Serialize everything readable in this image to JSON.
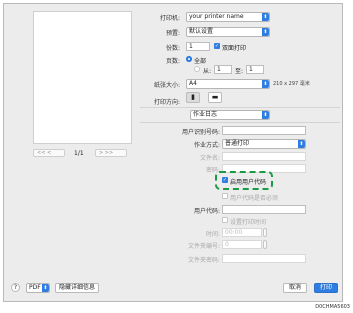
{
  "printer": {
    "label": "打印机:",
    "value": "your printer name"
  },
  "preset": {
    "label": "预置:",
    "value": "默认设置"
  },
  "copies": {
    "label": "份数:",
    "value": "1",
    "duplex_label": "双面打印"
  },
  "pages": {
    "label": "页数:",
    "all_label": "全部",
    "from_label": "从:",
    "from_value": "1",
    "to_label": "至:",
    "to_value": "1"
  },
  "paper_size": {
    "label": "纸张大小:",
    "value": "A4",
    "dimensions": "210 x 297 毫米"
  },
  "orientation": {
    "label": "打印方向:"
  },
  "section_menu": {
    "value": "作业日志"
  },
  "preview": {
    "page_indicator": "1/1",
    "prev": "<<  <",
    "next": ">  >>"
  },
  "job": {
    "user_id_label": "用户识别号码:",
    "job_type_label": "作业方式:",
    "job_type_value": "普通打印",
    "file_name_label": "文件名:",
    "password_label": "密码:",
    "use_user_code_label": "启用用户代码",
    "user_code_required_label": "用户代码是否必须",
    "user_code_label": "用户代码:",
    "set_print_time_label": "设置打印时间",
    "time_label": "时间:",
    "time_value": "00:00",
    "folder_number_label": "文件夹编号:",
    "folder_number_value": "0",
    "folder_password_label": "文件夹密码:"
  },
  "footer": {
    "help": "?",
    "pdf": "PDF",
    "hide_details": "隐藏详细信息",
    "cancel": "取消",
    "print": "打印"
  },
  "figure_code": "D0CHMA5603",
  "colors": {
    "accent": "#2f7de1",
    "highlight": "#1a9a45"
  },
  "icons": {
    "help": "question-icon",
    "chevron": "chevron-down-icon",
    "portrait": "portrait-orientation-icon",
    "landscape": "landscape-orientation-icon"
  }
}
